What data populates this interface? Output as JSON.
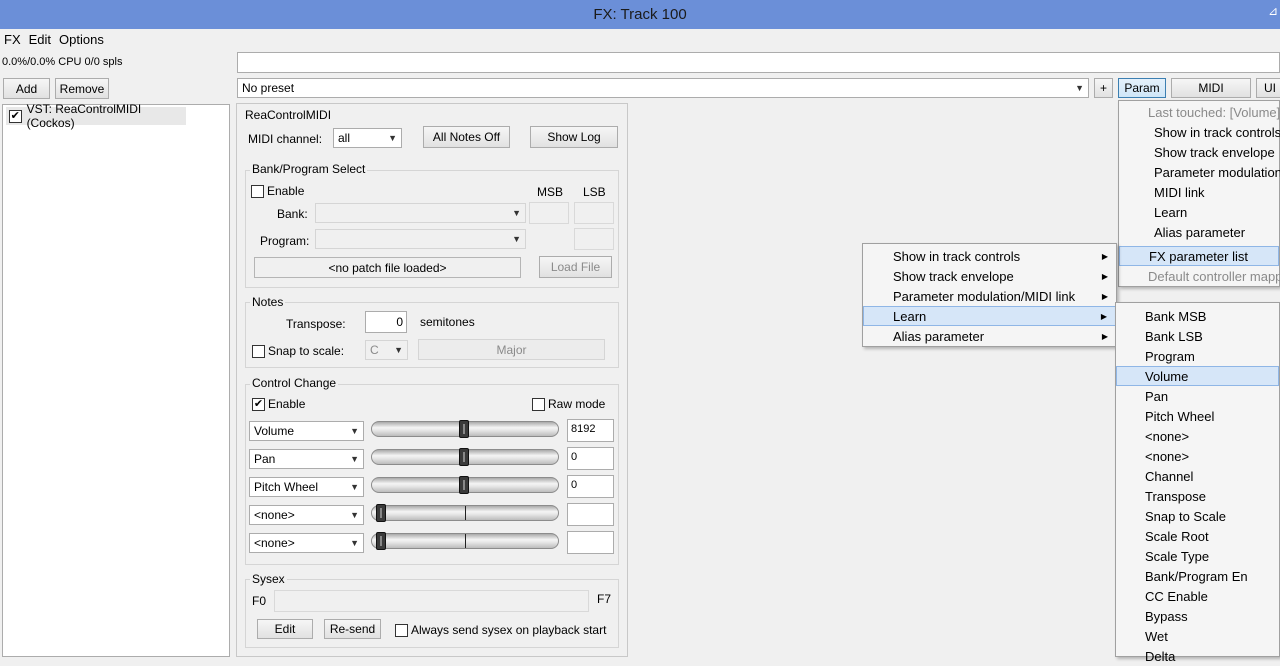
{
  "window": {
    "title": "FX: Track 100"
  },
  "menubar": {
    "fx": "FX",
    "edit": "Edit",
    "options": "Options"
  },
  "status": {
    "cpu": "0.0%/0.0% CPU 0/0 spls"
  },
  "fx_list": {
    "add": "Add",
    "remove": "Remove",
    "items": [
      "VST: ReaControlMIDI (Cockos)"
    ]
  },
  "preset": {
    "value": "No preset",
    "plus": "+",
    "param": "Param",
    "midi": "MIDI",
    "ui": "UI"
  },
  "plugin": {
    "name": "ReaControlMIDI",
    "midi_channel_label": "MIDI channel:",
    "midi_channel_value": "all",
    "all_notes_off": "All Notes Off",
    "show_log": "Show Log",
    "bank_program": {
      "title": "Bank/Program Select",
      "enable": "Enable",
      "msb": "MSB",
      "lsb": "LSB",
      "bank_label": "Bank:",
      "program_label": "Program:",
      "patch_file": "<no patch file loaded>",
      "load_file": "Load File"
    },
    "notes": {
      "title": "Notes",
      "transpose_label": "Transpose:",
      "transpose_value": "0",
      "semitones": "semitones",
      "snap_label": "Snap to scale:",
      "scale_root": "C",
      "scale_type": "Major"
    },
    "control_change": {
      "title": "Control Change",
      "enable": "Enable",
      "raw_mode": "Raw mode",
      "rows": [
        {
          "param": "Volume",
          "value": "8192",
          "position": 0.5
        },
        {
          "param": "Pan",
          "value": "0",
          "position": 0.5
        },
        {
          "param": "Pitch Wheel",
          "value": "0",
          "position": 0.5
        },
        {
          "param": "<none>",
          "value": "",
          "position": 0.0
        },
        {
          "param": "<none>",
          "value": "",
          "position": 0.0
        }
      ]
    },
    "sysex": {
      "title": "Sysex",
      "f0": "F0",
      "f7": "F7",
      "edit": "Edit",
      "resend": "Re-send",
      "always_send": "Always send sysex on playback start"
    }
  },
  "param_menu": {
    "last_touched": "Last touched: [Volume]",
    "items": [
      "Show in track controls",
      "Show track envelope",
      "Parameter modulation/",
      "MIDI link",
      "Learn",
      "Alias parameter"
    ],
    "fx_param_list": "FX parameter list",
    "default_controller": "Default controller mapp"
  },
  "context_menu": {
    "items": [
      "Show in track controls",
      "Show track envelope",
      "Parameter modulation/MIDI link",
      "Learn",
      "Alias parameter"
    ]
  },
  "param_list": {
    "items": [
      "Bank MSB",
      "Bank LSB",
      "Program",
      "Volume",
      "Pan",
      "Pitch Wheel",
      "<none>",
      "<none>",
      "Channel",
      "Transpose",
      "Snap to Scale",
      "Scale Root",
      "Scale Type",
      "Bank/Program En",
      "CC Enable",
      "Bypass",
      "Wet",
      "Delta"
    ]
  },
  "colors": {
    "titlebar": "#6b8fd8",
    "highlight": "#d6e6f8",
    "highlight_border": "#8fb6e6"
  }
}
